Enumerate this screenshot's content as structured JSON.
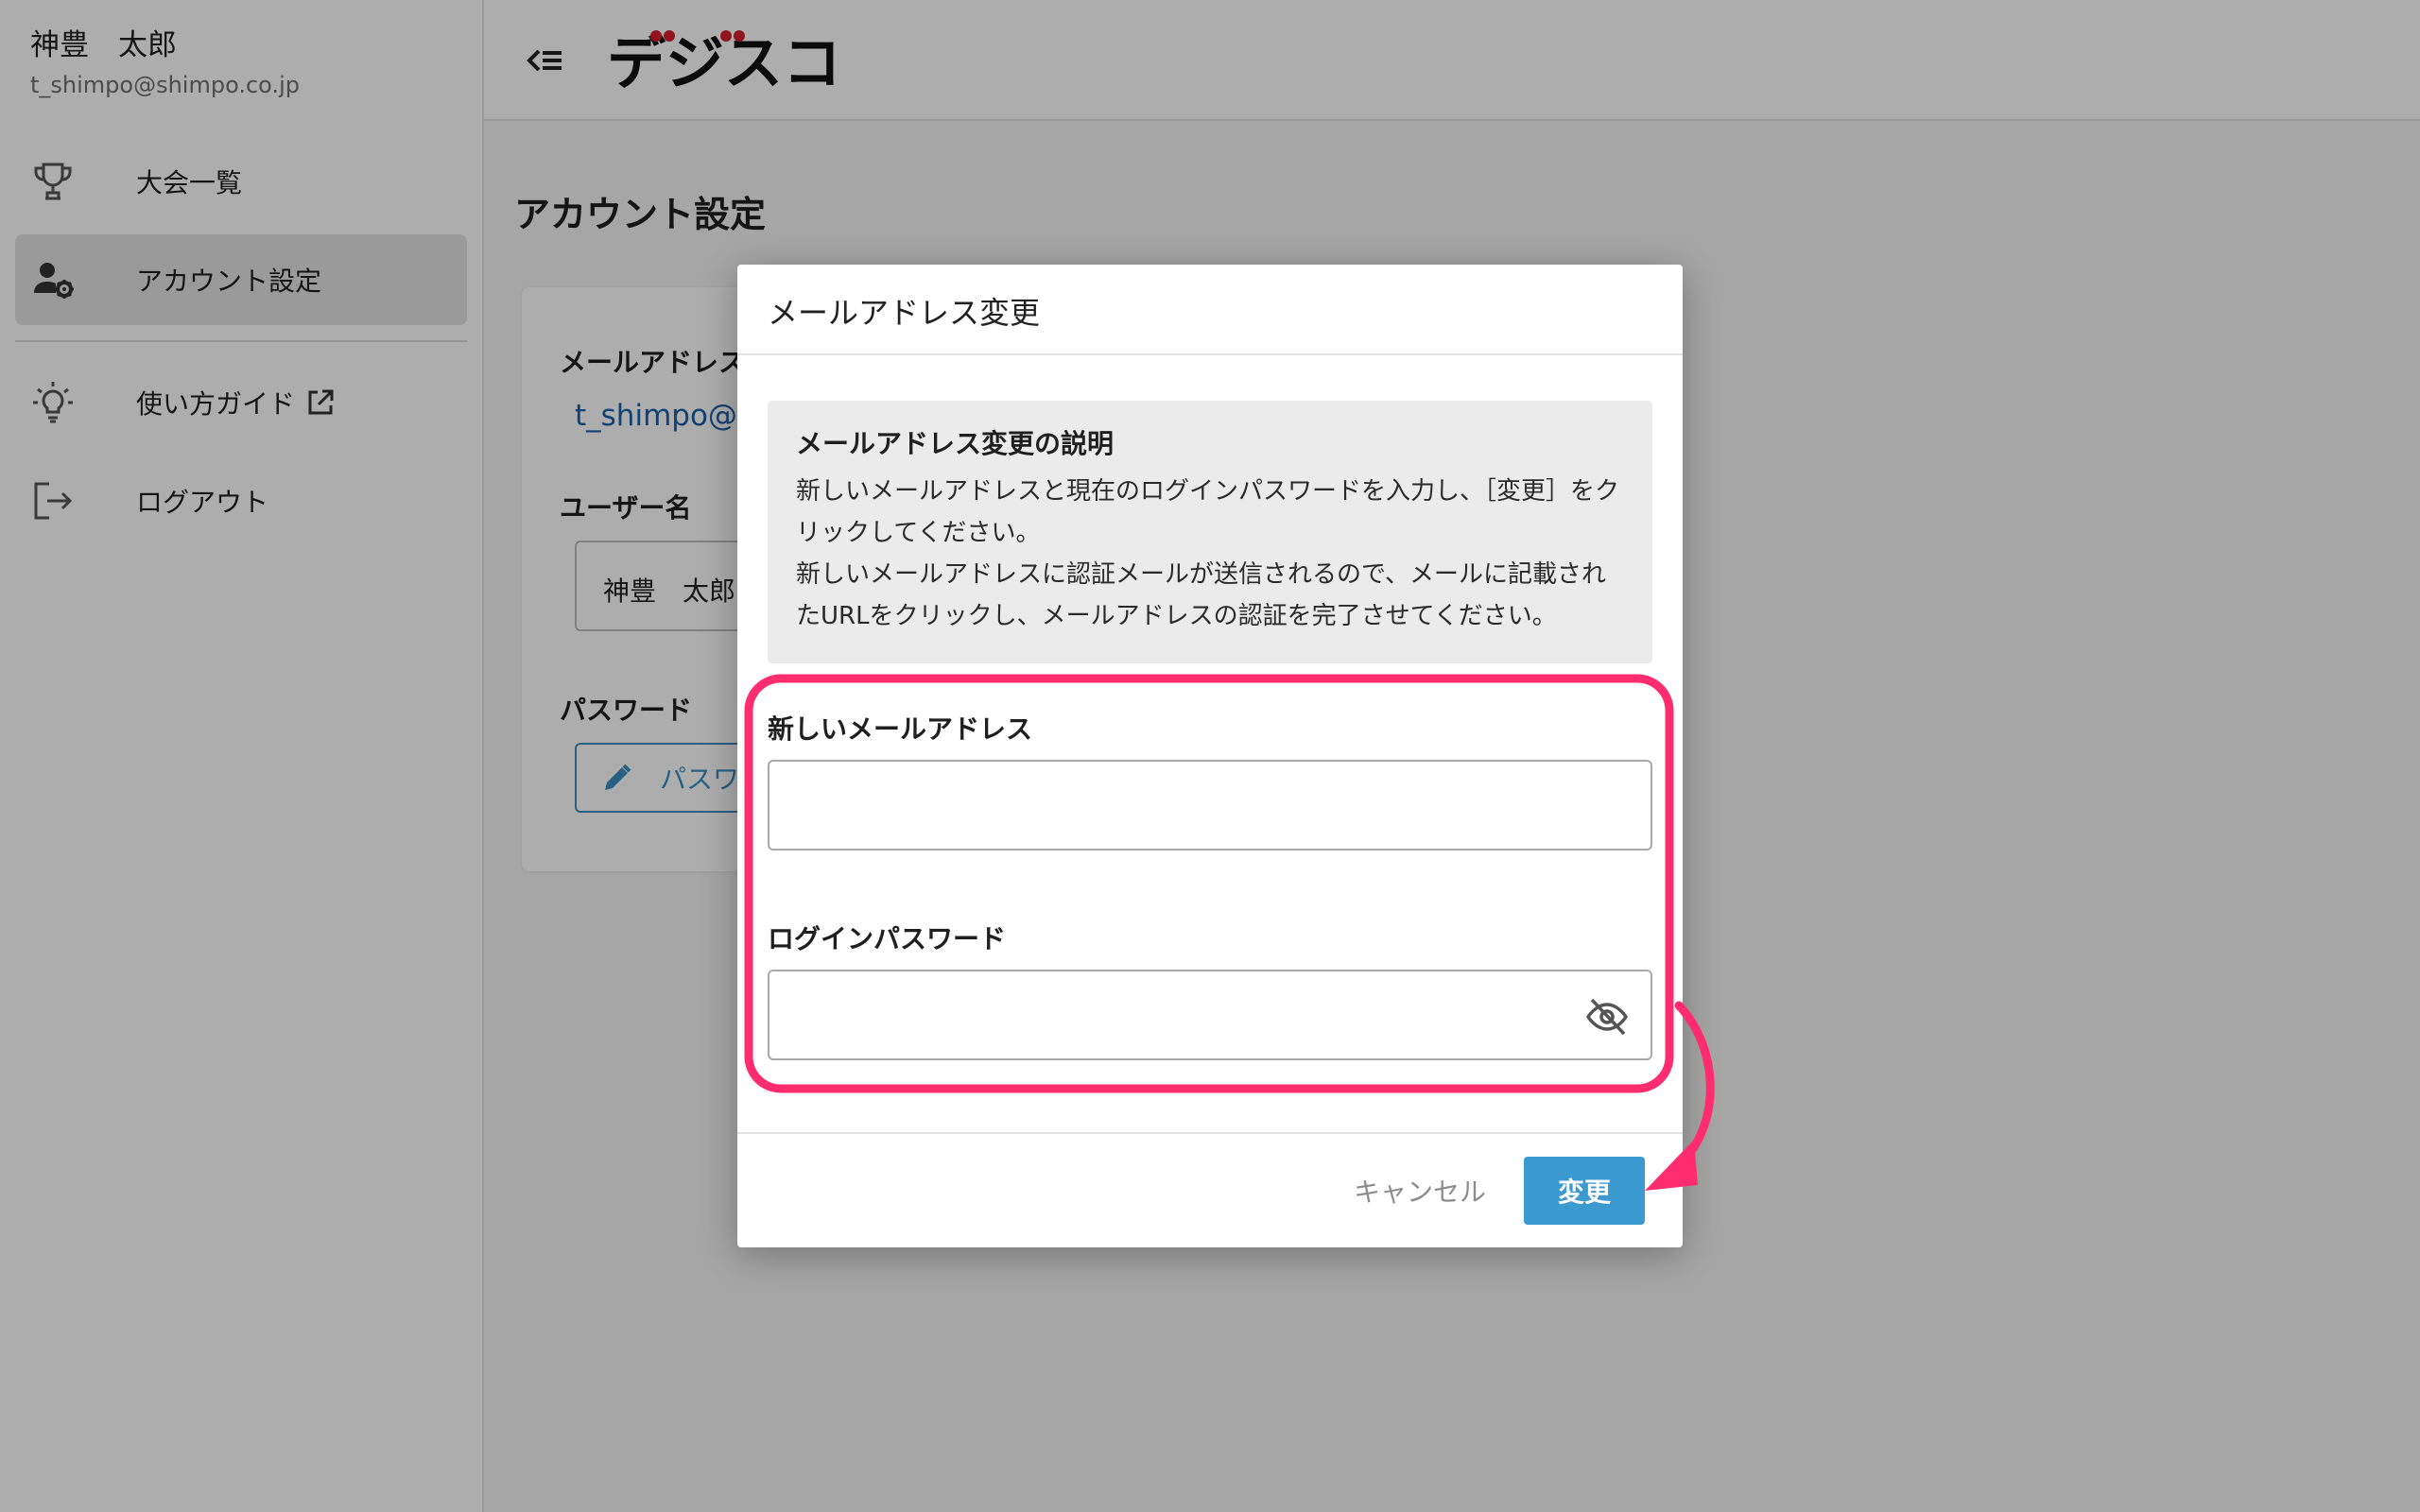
{
  "sidebar": {
    "user_name": "神豊　太郎",
    "user_email": "t_shimpo@shimpo.co.jp",
    "items": [
      {
        "label": "大会一覧",
        "icon": "trophy-icon"
      },
      {
        "label": "アカウント設定",
        "icon": "user-gear-icon",
        "active": true
      },
      {
        "label": "使い方ガイド",
        "icon": "lightbulb-icon",
        "external": "external-link-icon"
      },
      {
        "label": "ログアウト",
        "icon": "logout-icon"
      }
    ]
  },
  "header": {
    "back_icon": "collapse-menu-icon",
    "logo_text": "デジスコ"
  },
  "page": {
    "title": "アカウント設定",
    "email_label": "メールアドレス",
    "email_value": "t_shimpo@",
    "username_label": "ユーザー名",
    "username_value": "神豊　太郎",
    "password_label": "パスワード",
    "password_button": "パスワ"
  },
  "dialog": {
    "title": "メールアドレス変更",
    "info_title": "メールアドレス変更の説明",
    "info_line1": "新しいメールアドレスと現在のログインパスワードを入力し、［変更］をクリックしてください。",
    "info_line2": "新しいメールアドレスに認証メールが送信されるので、メールに記載されたURLをクリックし、メールアドレスの認証を完了させてください。",
    "new_email_label": "新しいメールアドレス",
    "new_email_value": "",
    "password_label": "ログインパスワード",
    "password_value": "",
    "eye_icon": "eye-off-icon",
    "cancel_label": "キャンセル",
    "submit_label": "変更"
  },
  "colors": {
    "accent": "#3b9ad0",
    "link": "#1a5fa8",
    "annotation": "#ff2d6f",
    "logo_dots": "#d6202f"
  }
}
